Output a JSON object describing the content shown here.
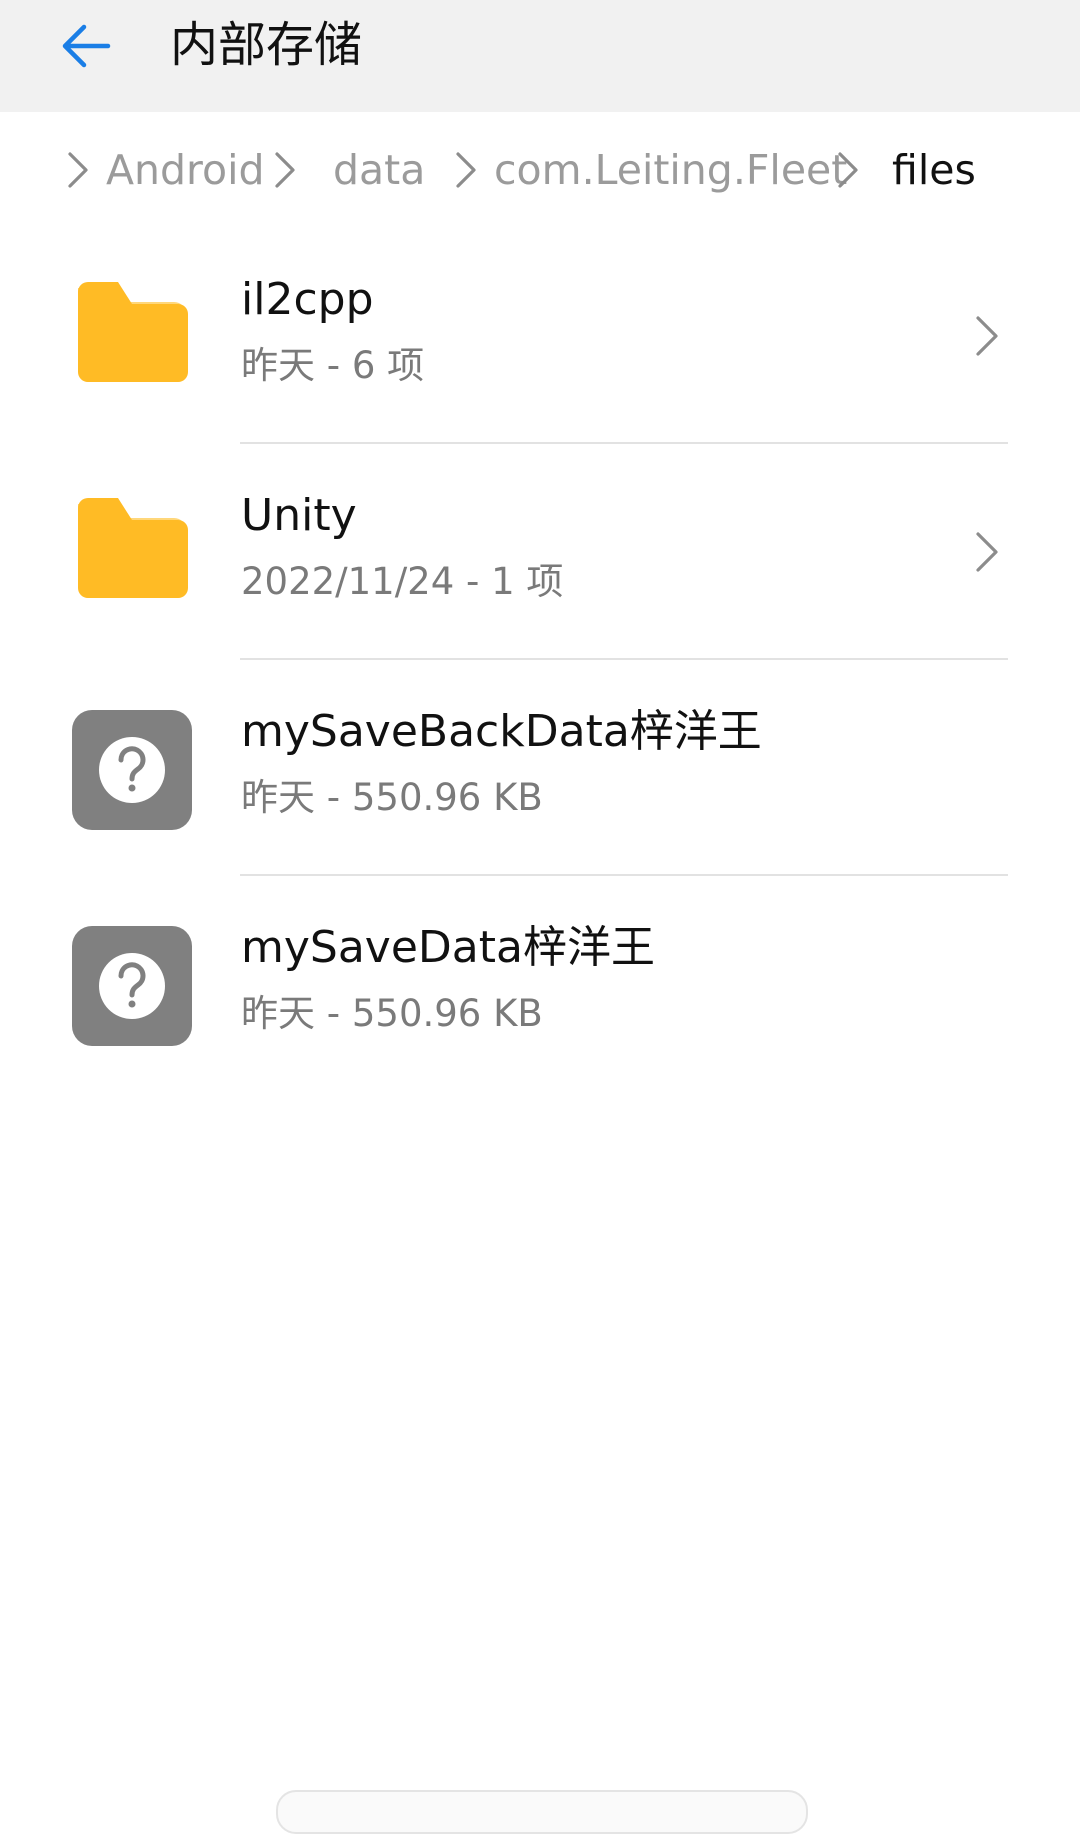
{
  "header": {
    "title": "内部存储"
  },
  "breadcrumb": [
    {
      "label": "Android"
    },
    {
      "label": "data"
    },
    {
      "label": "com.Leiting.Fleet"
    },
    {
      "label": "files"
    }
  ],
  "files": [
    {
      "name": "il2cpp",
      "meta": "昨天 - 6 项",
      "type": "folder",
      "icon": "folder-icon"
    },
    {
      "name": "Unity",
      "meta": "2022/11/24 - 1 项",
      "type": "folder",
      "icon": "folder-icon"
    },
    {
      "name": "mySaveBackData梓洋王",
      "meta": "昨天 - 550.96 KB",
      "type": "unknown-file",
      "icon": "unknown-file-icon"
    },
    {
      "name": "mySaveData梓洋王",
      "meta": "昨天 - 550.96 KB",
      "type": "unknown-file",
      "icon": "unknown-file-icon"
    }
  ],
  "colors": {
    "accent": "#1a7ee6",
    "folder": "#ffbb25",
    "folder_tab": "#ffd77a",
    "unknown_file": "#808080",
    "app_bar": "#f1f1f1"
  }
}
